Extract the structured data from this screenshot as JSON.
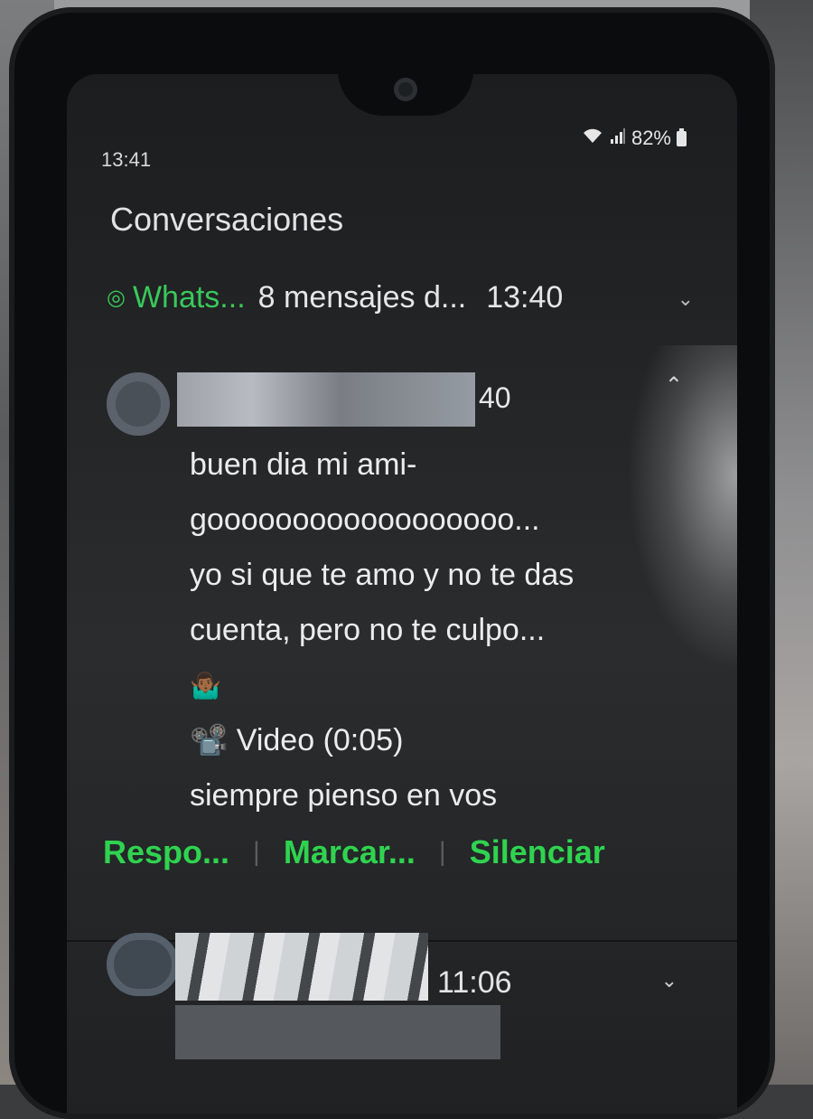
{
  "status_bar": {
    "time": "13:41",
    "battery": "82%"
  },
  "title": "Conversaciones",
  "notification_header": {
    "app": "Whats...",
    "summary": "8 mensajes d...",
    "time": "13:40"
  },
  "message": {
    "time_partial": "40",
    "lines": [
      "buen dia mi ami-",
      "goooooooooooooooooo...",
      "yo si que te amo y no te das",
      "cuenta, pero no te culpo...",
      "🤷🏾‍♂️",
      "📽️ Video (0:05)",
      "siempre pienso en vos"
    ]
  },
  "actions": [
    {
      "label": "Respo..."
    },
    {
      "label": "Marcar..."
    },
    {
      "label": "Silenciar"
    }
  ],
  "second_notification": {
    "time": "11:06"
  },
  "colors": {
    "accent": "#2fd34f",
    "background": "#1f2123",
    "text": "#ececec"
  },
  "icons": [
    "wifi-icon",
    "signal-icon",
    "battery-icon",
    "whatsapp-icon",
    "chevron-down-icon",
    "chevron-up-icon"
  ]
}
